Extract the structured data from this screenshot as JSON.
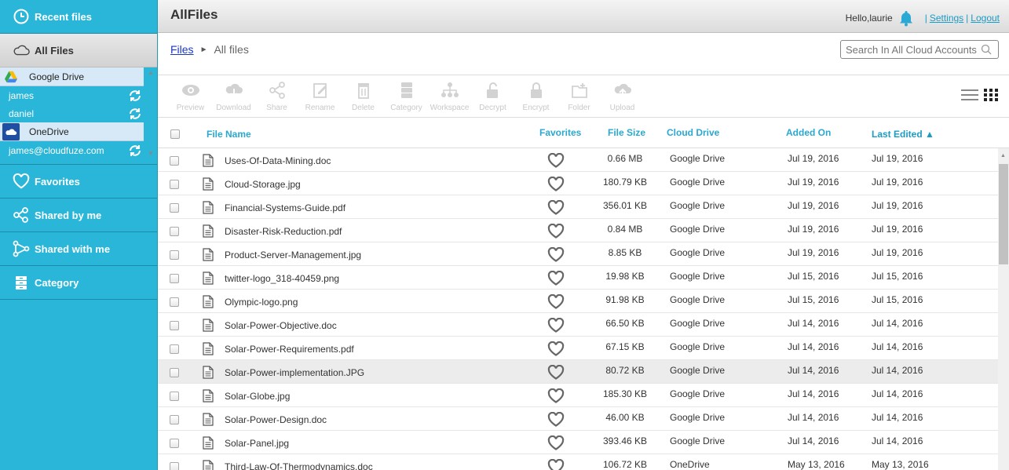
{
  "sidebar": {
    "recent_files": "Recent files",
    "all_files": "All Files",
    "favorites": "Favorites",
    "shared_by_me": "Shared by me",
    "shared_with_me": "Shared with me",
    "category": "Category",
    "accounts": {
      "google_drive": "Google Drive",
      "google_users": [
        "james",
        "daniel"
      ],
      "onedrive": "OneDrive",
      "onedrive_users": [
        "james@cloudfuze.com"
      ]
    }
  },
  "header": {
    "title": "AllFiles",
    "greeting": "Hello, ",
    "user": "laurie",
    "settings": "Settings",
    "logout": "Logout",
    "separator": "|"
  },
  "breadcrumb": {
    "root": "Files",
    "arrow": "►",
    "current": "All files"
  },
  "search": {
    "placeholder": "Search In All Cloud Accounts"
  },
  "toolbar": {
    "preview": "Preview",
    "download": "Download",
    "share": "Share",
    "rename": "Rename",
    "delete": "Delete",
    "category": "Category",
    "workspace": "Workspace",
    "decrypt": "Decrypt",
    "encrypt": "Encrypt",
    "folder": "Folder",
    "upload": "Upload"
  },
  "table": {
    "headers": {
      "file_name": "File Name",
      "favorites": "Favorites",
      "file_size": "File Size",
      "cloud_drive": "Cloud Drive",
      "added_on": "Added On",
      "last_edited": "Last Edited ▲"
    },
    "rows": [
      {
        "name": "Uses-Of-Data-Mining.doc",
        "size": "0.66 MB",
        "drive": "Google Drive",
        "added": "Jul 19, 2016",
        "edited": "Jul 19, 2016"
      },
      {
        "name": "Cloud-Storage.jpg",
        "size": "180.79 KB",
        "drive": "Google Drive",
        "added": "Jul 19, 2016",
        "edited": "Jul 19, 2016"
      },
      {
        "name": "Financial-Systems-Guide.pdf",
        "size": "356.01 KB",
        "drive": "Google Drive",
        "added": "Jul 19, 2016",
        "edited": "Jul 19, 2016"
      },
      {
        "name": "Disaster-Risk-Reduction.pdf",
        "size": "0.84 MB",
        "drive": "Google Drive",
        "added": "Jul 19, 2016",
        "edited": "Jul 19, 2016"
      },
      {
        "name": "Product-Server-Management.jpg",
        "size": "8.85 KB",
        "drive": "Google Drive",
        "added": "Jul 19, 2016",
        "edited": "Jul 19, 2016"
      },
      {
        "name": "twitter-logo_318-40459.png",
        "size": "19.98 KB",
        "drive": "Google Drive",
        "added": "Jul 15, 2016",
        "edited": "Jul 15, 2016"
      },
      {
        "name": "Olympic-logo.png",
        "size": "91.98 KB",
        "drive": "Google Drive",
        "added": "Jul 15, 2016",
        "edited": "Jul 15, 2016"
      },
      {
        "name": "Solar-Power-Objective.doc",
        "size": "66.50 KB",
        "drive": "Google Drive",
        "added": "Jul 14, 2016",
        "edited": "Jul 14, 2016"
      },
      {
        "name": "Solar-Power-Requirements.pdf",
        "size": "67.15 KB",
        "drive": "Google Drive",
        "added": "Jul 14, 2016",
        "edited": "Jul 14, 2016"
      },
      {
        "name": "Solar-Power-implementation.JPG",
        "size": "80.72 KB",
        "drive": "Google Drive",
        "added": "Jul 14, 2016",
        "edited": "Jul 14, 2016"
      },
      {
        "name": "Solar-Globe.jpg",
        "size": "185.30 KB",
        "drive": "Google Drive",
        "added": "Jul 14, 2016",
        "edited": "Jul 14, 2016"
      },
      {
        "name": "Solar-Power-Design.doc",
        "size": "46.00 KB",
        "drive": "Google Drive",
        "added": "Jul 14, 2016",
        "edited": "Jul 14, 2016"
      },
      {
        "name": "Solar-Panel.jpg",
        "size": "393.46 KB",
        "drive": "Google Drive",
        "added": "Jul 14, 2016",
        "edited": "Jul 14, 2016"
      },
      {
        "name": "Third-Law-Of-Thermodynamics.doc",
        "size": "106.72 KB",
        "drive": "OneDrive",
        "added": "May 13, 2016",
        "edited": "May 13, 2016"
      }
    ]
  },
  "colors": {
    "sidebar": "#29b6d8",
    "accent": "#2aa8cf",
    "link": "#1a37c4"
  }
}
